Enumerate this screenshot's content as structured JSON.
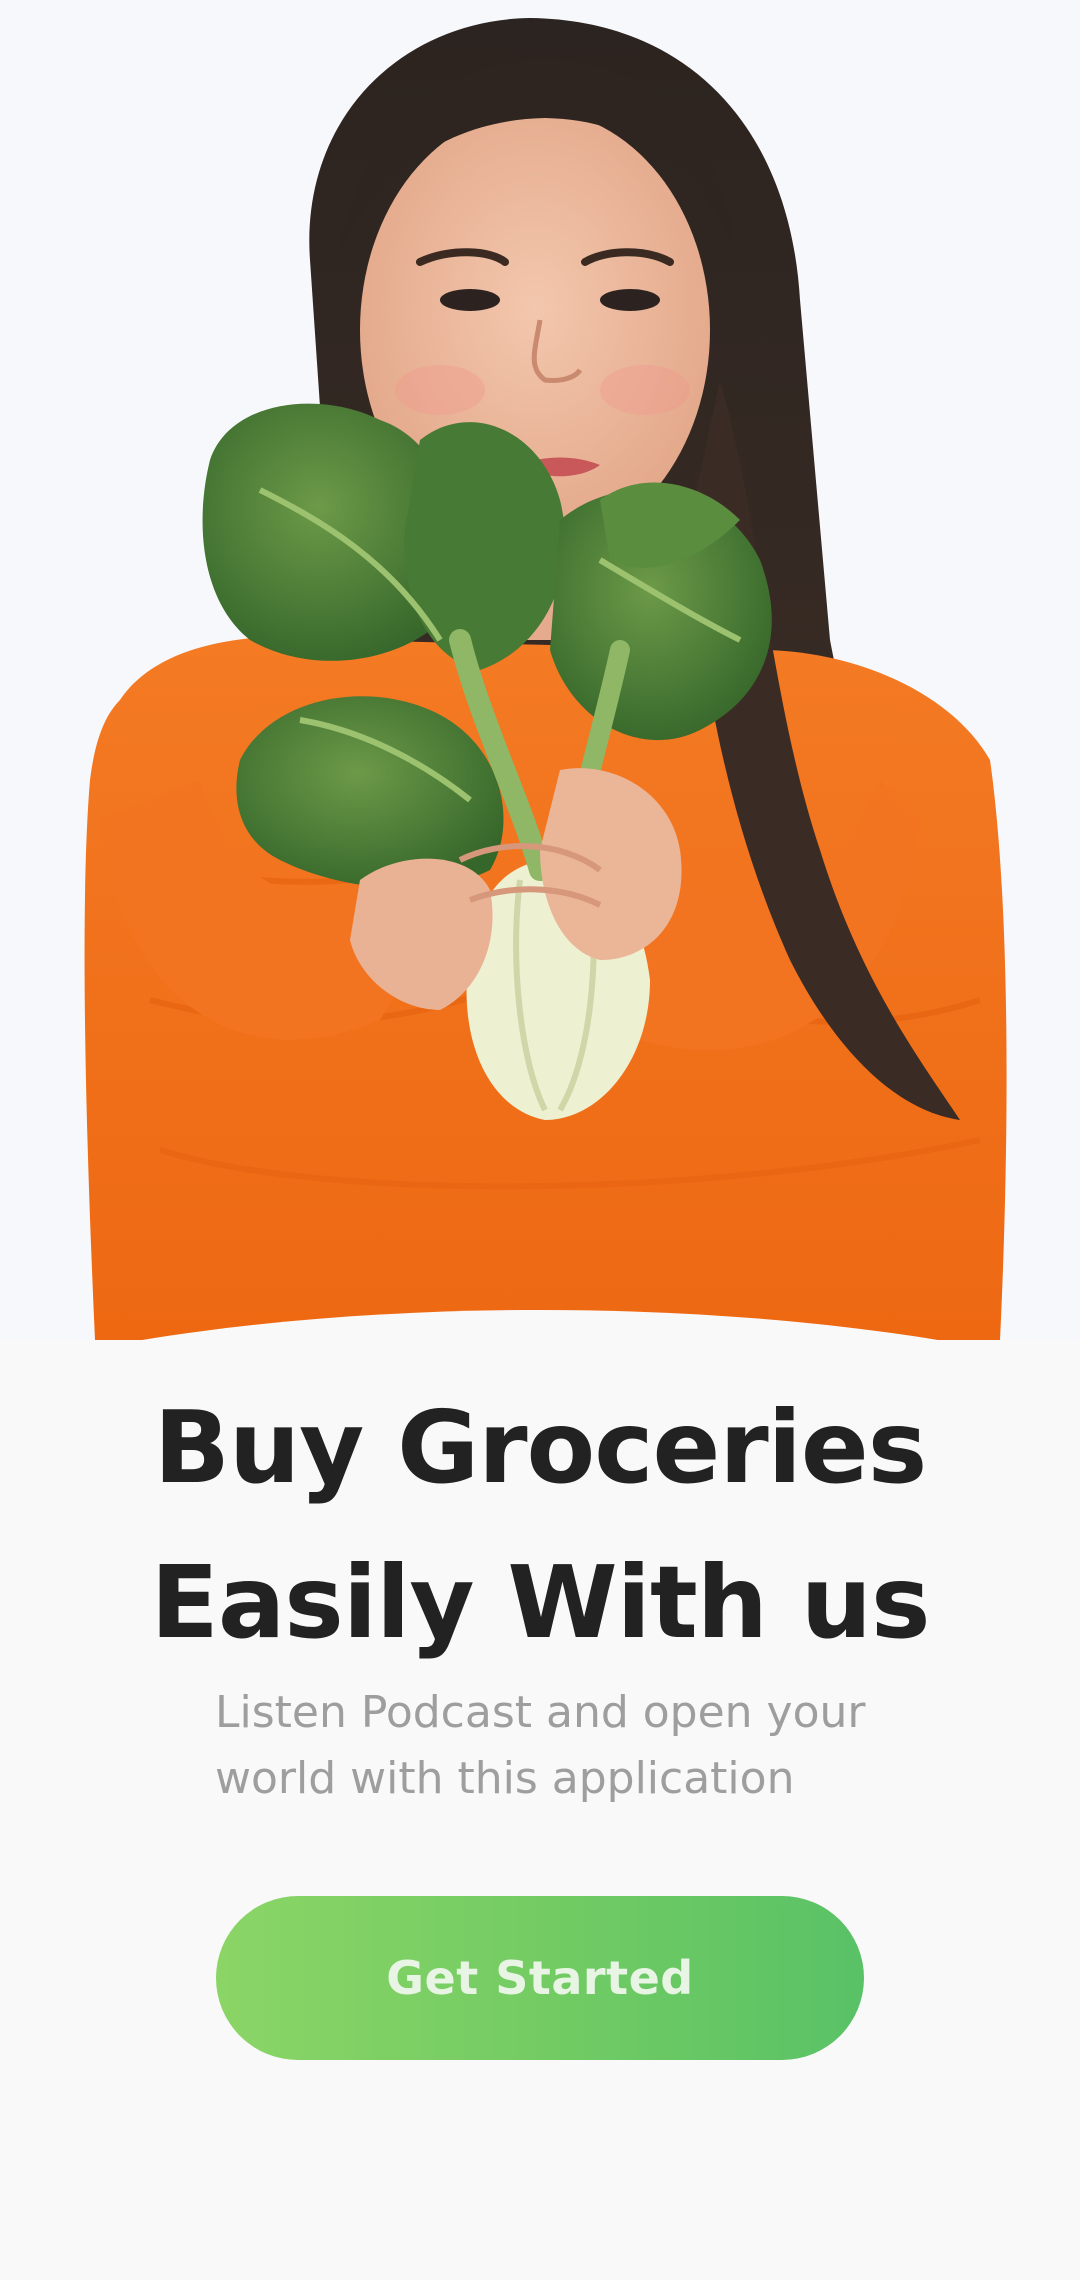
{
  "onboarding": {
    "title_line1": "Buy Groceries",
    "title_line2": "Easily With us",
    "subtitle": "Listen Podcast and open your world with this application",
    "cta_label": "Get Started"
  },
  "hero": {
    "image": "woman-holding-bok-choy"
  },
  "colors": {
    "background": "#f9f9fa",
    "title": "#222222",
    "subtitle": "#9e9e9e",
    "button_gradient_start": "#8bd566",
    "button_gradient_end": "#59c266",
    "button_text": "#e8f4e4",
    "sweater": "#f4721c"
  }
}
